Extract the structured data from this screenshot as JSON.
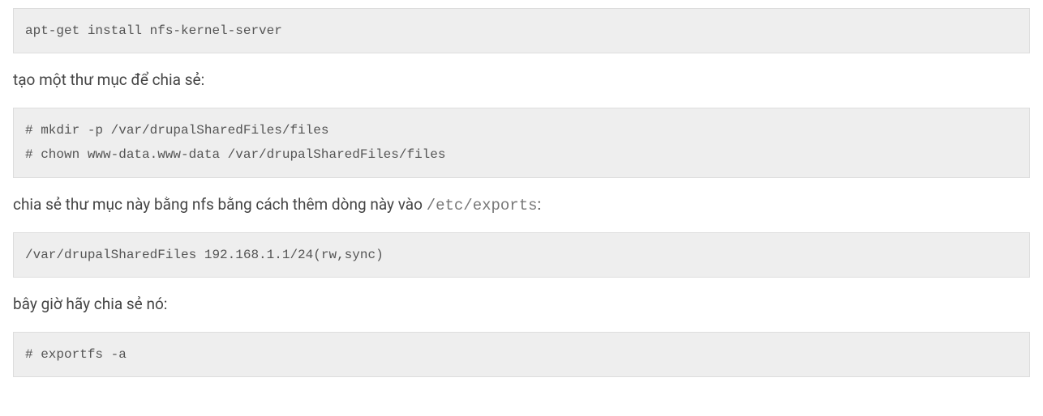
{
  "blocks": {
    "code1": "apt-get install nfs-kernel-server",
    "para1": "tạo một thư mục để chia sẻ:",
    "code2": "# mkdir -p /var/drupalSharedFiles/files\n# chown www-data.www-data /var/drupalSharedFiles/files",
    "para2_prefix": "chia sẻ thư mục này bằng nfs bằng cách thêm dòng này vào ",
    "para2_code": "/etc/exports",
    "para2_suffix": ":",
    "code3": "/var/drupalSharedFiles 192.168.1.1/24(rw,sync)",
    "para3": "bây giờ hãy chia sẻ nó:",
    "code4": "# exportfs -a"
  }
}
